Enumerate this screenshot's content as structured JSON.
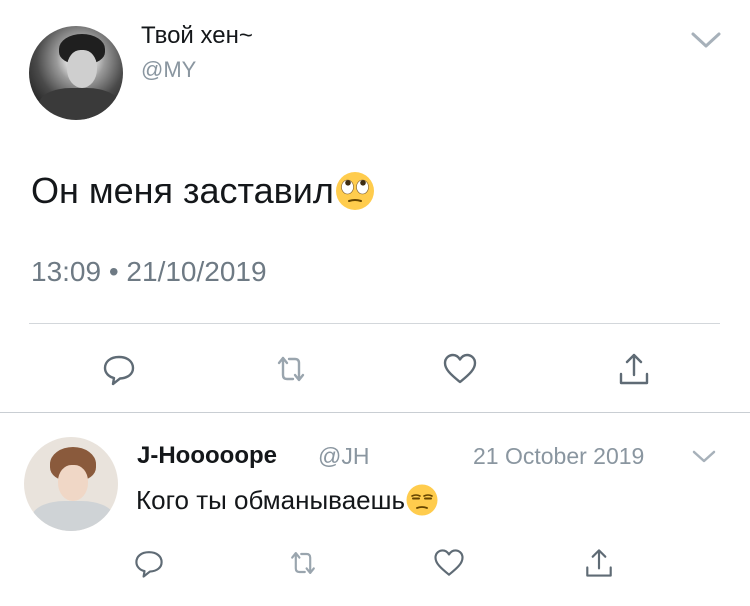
{
  "tweet": {
    "display_name": "Твой хен~",
    "handle": "@MY",
    "text": "Он меня заставил",
    "emoji": "face-with-rolling-eyes",
    "timestamp": "13:09 • 21/10/2019"
  },
  "reply": {
    "display_name": "J-Hooooope",
    "handle": "@JH",
    "date": "21 October 2019",
    "text": "Кого ты обманываешь",
    "emoji": "unamused-face"
  },
  "icons": {
    "reply": "reply-icon",
    "retweet": "retweet-icon",
    "like": "heart-icon",
    "share": "share-icon",
    "menu": "chevron-down-icon"
  },
  "colors": {
    "text": "#14171a",
    "secondary": "#8a96a0",
    "divider": "#d3d7db",
    "emoji": "#ffcc4d"
  }
}
